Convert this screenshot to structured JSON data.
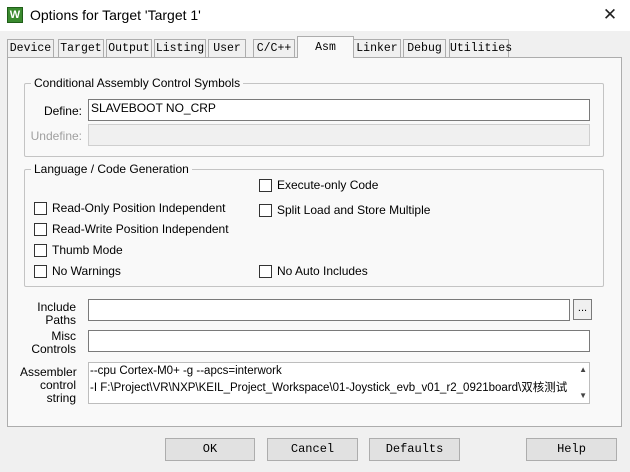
{
  "window": {
    "title": "Options for Target 'Target 1'",
    "close": "✕"
  },
  "tabs": [
    {
      "label": "Device"
    },
    {
      "label": "Target"
    },
    {
      "label": "Output"
    },
    {
      "label": "Listing"
    },
    {
      "label": "User"
    },
    {
      "label": "C/C++"
    },
    {
      "label": "Asm",
      "active": true
    },
    {
      "label": "Linker"
    },
    {
      "label": "Debug"
    },
    {
      "label": "Utilities"
    }
  ],
  "conditional": {
    "legend": "Conditional Assembly Control Symbols",
    "define_label": "Define:",
    "define_value": "SLAVEBOOT NO_CRP",
    "undefine_label": "Undefine:",
    "undefine_value": ""
  },
  "language": {
    "legend": "Language / Code Generation",
    "options": {
      "execute_only": {
        "label": "Execute-only Code",
        "checked": false
      },
      "ropi": {
        "label": "Read-Only Position Independent",
        "checked": false
      },
      "split_load": {
        "label": "Split Load and Store Multiple",
        "checked": false
      },
      "rwpi": {
        "label": "Read-Write Position Independent",
        "checked": false
      },
      "thumb": {
        "label": "Thumb Mode",
        "checked": false
      },
      "no_warnings": {
        "label": "No Warnings",
        "checked": false
      },
      "no_auto_includes": {
        "label": "No Auto Includes",
        "checked": false
      }
    }
  },
  "include": {
    "label_1": "Include",
    "label_2": "Paths",
    "value": "",
    "browse": "..."
  },
  "misc": {
    "label_1": "Misc",
    "label_2": "Controls",
    "value": ""
  },
  "assembler": {
    "label_1": "Assembler",
    "label_2": "control",
    "label_3": "string",
    "line_1": "--cpu Cortex-M0+ -g --apcs=interwork",
    "line_2": "-I F:\\Project\\VR\\NXP\\KEIL_Project_Workspace\\01-Joystick_evb_v01_r2_0921board\\双核测试"
  },
  "buttons": {
    "ok": "OK",
    "cancel": "Cancel",
    "defaults": "Defaults",
    "help": "Help"
  },
  "colors": {
    "app_icon": "#3a8a2e",
    "window_bg": "#f0f0f0",
    "panel_bg": "#f9f9f9"
  }
}
